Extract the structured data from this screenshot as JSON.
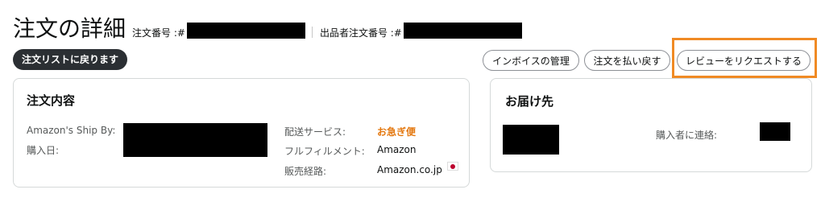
{
  "header": {
    "page_title": "注文の詳細",
    "order_number_label": "注文番号 :#",
    "seller_order_number_label": "出品者注文番号 :#"
  },
  "toolbar": {
    "back_label": "注文リストに戻ります",
    "invoice_label": "インボイスの管理",
    "refund_label": "注文を払い戻す",
    "review_label": "レビューをリクエストする"
  },
  "order_card": {
    "title": "注文内容",
    "ship_by_label": "Amazon's Ship By:",
    "purchase_date_label": "購入日:",
    "shipping_service_label": "配送サービス:",
    "shipping_service_value": "お急ぎ便",
    "fulfillment_label": "フルフィルメント:",
    "fulfillment_value": "Amazon",
    "sales_channel_label": "販売経路:",
    "sales_channel_value": "Amazon.co.jp"
  },
  "ship_card": {
    "title": "お届け先",
    "contact_buyer_label": "購入者に連絡:"
  },
  "colors": {
    "accent_orange": "#e47911",
    "highlight_orange": "#f08a24",
    "back_button_bg": "#2b2f33"
  },
  "icons": {
    "sales_channel_flag": "japan-flag-icon"
  }
}
